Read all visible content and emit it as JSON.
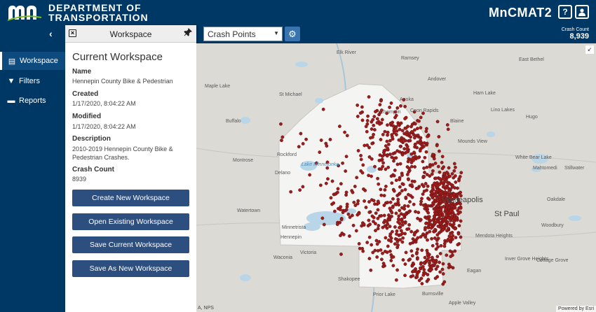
{
  "header": {
    "logo_text_line1": "DEPARTMENT OF",
    "logo_text_line2": "TRANSPORTATION",
    "app_title": "MnCMAT2",
    "help_icon": "question-icon",
    "user_icon": "user-icon"
  },
  "toolbar": {
    "layer_select_value": "Crash Points",
    "crash_count_label": "Crash Count",
    "crash_count_value": "8,939"
  },
  "nav": {
    "collapse_glyph": "‹",
    "items": [
      {
        "label": "Workspace",
        "icon": "clipboard-icon"
      },
      {
        "label": "Filters",
        "icon": "filter-icon"
      },
      {
        "label": "Reports",
        "icon": "document-icon"
      }
    ]
  },
  "panel": {
    "title": "Workspace",
    "heading": "Current Workspace",
    "fields": [
      {
        "label": "Name",
        "value": "Hennepin County Bike & Pedestrian"
      },
      {
        "label": "Created",
        "value": "1/17/2020, 8:04:22 AM"
      },
      {
        "label": "Modified",
        "value": "1/17/2020, 8:04:22 AM"
      },
      {
        "label": "Description",
        "value": "2010-2019 Hennepin County Bike & Pedestrian Crashes."
      },
      {
        "label": "Crash Count",
        "value": "8939"
      }
    ],
    "buttons": [
      "Create New Workspace",
      "Open Existing Workspace",
      "Save Current Workspace",
      "Save As New Workspace"
    ]
  },
  "map": {
    "places": [
      "Elk River",
      "Ramsey",
      "Andover",
      "Maple Lake",
      "St Michael",
      "Anoka",
      "Coon Rapids",
      "Ham Lake",
      "East Bethel",
      "Champlin",
      "Lino Lakes",
      "Blaine",
      "Hugo",
      "Buffalo",
      "Rockford",
      "Mounds View",
      "Delano",
      "Montrose",
      "Lake Minnetonka",
      "Minneapolis",
      "St Paul",
      "White Bear Lake",
      "Mahtomedi",
      "Stillwater",
      "Oakdale",
      "Watertown",
      "Minnetrista",
      "Woodbury",
      "Waconia",
      "Victoria",
      "Mendota Heights",
      "Inver Grove Heights",
      "Cottage Grove",
      "Eagan",
      "Shakopee",
      "Apple Valley",
      "Burnsville",
      "Prior Lake",
      "Hennepin"
    ],
    "attribution_left": "A, NPS",
    "attribution_right": "Powered by Esri",
    "crash_point_color": "#9b1c1c",
    "county_fill_color": "#f4f4f2",
    "water_color": "#b9d5e8"
  }
}
